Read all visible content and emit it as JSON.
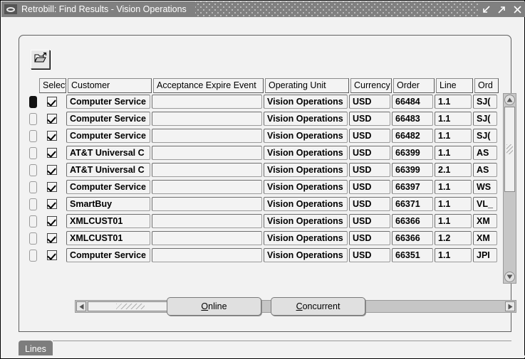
{
  "window": {
    "title": "Retrobill: Find Results - Vision Operations",
    "icon": "oval-icon",
    "minimize_label": "↙",
    "maximize_label": "↗",
    "close_label": "✕"
  },
  "toolbar": {
    "open_icon": "open-folder-icon",
    "open_tooltip": "Open"
  },
  "grid": {
    "headers": [
      "Select",
      "Customer",
      "Acceptance Expire Event",
      "Operating Unit",
      "Currency",
      "Order",
      "Line",
      "Ord"
    ],
    "rows": [
      {
        "current": true,
        "selected": true,
        "customer": "Computer Service",
        "acceptance_expire_event": "",
        "operating_unit": "Vision Operations",
        "currency": "USD",
        "order": "66484",
        "line": "1.1",
        "ord": "SJ("
      },
      {
        "current": false,
        "selected": true,
        "customer": "Computer Service",
        "acceptance_expire_event": "",
        "operating_unit": "Vision Operations",
        "currency": "USD",
        "order": "66483",
        "line": "1.1",
        "ord": "SJ("
      },
      {
        "current": false,
        "selected": true,
        "customer": "Computer Service",
        "acceptance_expire_event": "",
        "operating_unit": "Vision Operations",
        "currency": "USD",
        "order": "66482",
        "line": "1.1",
        "ord": "SJ("
      },
      {
        "current": false,
        "selected": true,
        "customer": "AT&T Universal C",
        "acceptance_expire_event": "",
        "operating_unit": "Vision Operations",
        "currency": "USD",
        "order": "66399",
        "line": "1.1",
        "ord": "AS"
      },
      {
        "current": false,
        "selected": true,
        "customer": "AT&T Universal C",
        "acceptance_expire_event": "",
        "operating_unit": "Vision Operations",
        "currency": "USD",
        "order": "66399",
        "line": "2.1",
        "ord": "AS"
      },
      {
        "current": false,
        "selected": true,
        "customer": "Computer Service",
        "acceptance_expire_event": "",
        "operating_unit": "Vision Operations",
        "currency": "USD",
        "order": "66397",
        "line": "1.1",
        "ord": "WS"
      },
      {
        "current": false,
        "selected": true,
        "customer": "SmartBuy",
        "acceptance_expire_event": "",
        "operating_unit": "Vision Operations",
        "currency": "USD",
        "order": "66371",
        "line": "1.1",
        "ord": "VL_"
      },
      {
        "current": false,
        "selected": true,
        "customer": "XMLCUST01",
        "acceptance_expire_event": "",
        "operating_unit": "Vision Operations",
        "currency": "USD",
        "order": "66366",
        "line": "1.1",
        "ord": "XM"
      },
      {
        "current": false,
        "selected": true,
        "customer": "XMLCUST01",
        "acceptance_expire_event": "",
        "operating_unit": "Vision Operations",
        "currency": "USD",
        "order": "66366",
        "line": "1.2",
        "ord": "XM"
      },
      {
        "current": false,
        "selected": true,
        "customer": "Computer Service",
        "acceptance_expire_event": "",
        "operating_unit": "Vision Operations",
        "currency": "USD",
        "order": "66351",
        "line": "1.1",
        "ord": "JPI"
      }
    ]
  },
  "scrollbars": {
    "vertical": {
      "up_label": "▲",
      "down_label": "▼"
    },
    "horizontal": {
      "left_label": "◀",
      "right_label": "▶"
    }
  },
  "buttons": {
    "online": {
      "prefix": "",
      "mnemonic": "O",
      "suffix": "nline"
    },
    "concurrent": {
      "prefix": "",
      "mnemonic": "C",
      "suffix": "oncurrent"
    }
  },
  "tabs": {
    "active": "Lines"
  },
  "colors": {
    "titlebar": "#808080",
    "window_bg": "#f2f2f2",
    "cell_bg": "#f3f3f3",
    "tab_active": "#7d7d7d",
    "scroll_track": "#c6c6c6"
  }
}
